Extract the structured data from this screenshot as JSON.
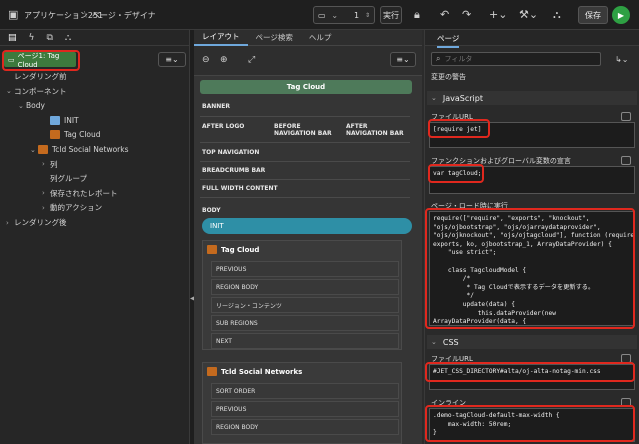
{
  "topbar": {
    "breadcrumb_app": "アプリケーション251",
    "breadcrumb_sep": "\\",
    "breadcrumb_page": "ページ・デザイナ",
    "page_number": "1",
    "run_label": "実行",
    "save_label": "保存"
  },
  "left": {
    "region_badge": "ページ1: Tag Cloud",
    "tree": [
      {
        "label": "レンダリング前",
        "indent": 0,
        "chev": ""
      },
      {
        "label": "コンポーネント",
        "indent": 0,
        "chev": "⌄"
      },
      {
        "label": "Body",
        "indent": 1,
        "chev": "⌄"
      },
      {
        "label": "INIT",
        "indent": 3,
        "chev": "",
        "icon": "init"
      },
      {
        "label": "Tag Cloud",
        "indent": 3,
        "chev": "",
        "icon": "code"
      },
      {
        "label": "Tcld Social Networks",
        "indent": 2,
        "chev": "⌄",
        "icon": "table"
      },
      {
        "label": "列",
        "indent": 3,
        "chev": "›"
      },
      {
        "label": "列グループ",
        "indent": 3,
        "chev": ""
      },
      {
        "label": "保存されたレポート",
        "indent": 3,
        "chev": "›"
      },
      {
        "label": "動的アクション",
        "indent": 3,
        "chev": "›"
      },
      {
        "label": "レンダリング後",
        "indent": 0,
        "chev": "›"
      }
    ]
  },
  "middle": {
    "tabs": [
      "レイアウト",
      "ページ検索",
      "ヘルプ"
    ],
    "page_title": "Tag Cloud",
    "zones": {
      "banner": "BANNER",
      "after_logo": "AFTER LOGO",
      "before_nav": "BEFORE NAVIGATION BAR",
      "after_nav": "AFTER NAVIGATION BAR",
      "top_nav": "TOP NAVIGATION",
      "breadcrumb_bar": "BREADCRUMB BAR",
      "full_width": "FULL WIDTH CONTENT",
      "body": "BODY"
    },
    "init_label": "INIT",
    "tag_cloud_region": "Tag Cloud",
    "tag_cloud_subs": [
      "PREVIOUS",
      "REGION BODY",
      "リージョン・コンテンツ",
      "SUB REGIONS",
      "NEXT"
    ],
    "social_region": "Tcld Social Networks",
    "social_subs": [
      "SORT ORDER",
      "PREVIOUS",
      "REGION BODY"
    ]
  },
  "right": {
    "tab_label": "ページ",
    "filter_placeholder": "フィルタ",
    "warn_label": "変更の警告",
    "js_section": "JavaScript",
    "file_url_label": "ファイルURL",
    "file_url_value": "[require jet]",
    "func_label": "ファンクションおよびグローバル変数の宣言",
    "func_value": "var tagCloud;",
    "onload_label": "ページ・ロード時に実行",
    "onload_value": "require([\"require\", \"exports\", \"knockout\",\n\"ojs/ojbootstrap\", \"ojs/ojarraydataprovider\",\n\"ojs/ojknockout\", \"ojs/ojtagcloud\"], function (require,\nexports, ko, ojbootstrap_1, ArrayDataProvider) {\n    \"use strict\";\n\n    class TagcloudModel {\n        /*\n         * Tag Cloudで表示するデータを更新する。\n         */\n        update(data) {\n            this.dataProvider(new\nArrayDataProvider(data, {\n                keyAttributes: \"id\",\n            }));",
    "css_section": "CSS",
    "css_file_label": "ファイルURL",
    "css_file_value": "#JET_CSS_DIRECTORY#alta/oj-alta-notag-min.css",
    "inline_label": "インライン",
    "inline_value": ".demo-tagCloud-default-max-width {\n    max-width: 50rem;\n}"
  },
  "colors": {
    "highlight": "#e0281e",
    "region_badge_bg": "#3d7a3d",
    "page_title_bg": "#4e7a5a",
    "init_bg": "#2e8fa6",
    "save_bg": "#3a3a3a",
    "run_green": "#2ea043"
  }
}
